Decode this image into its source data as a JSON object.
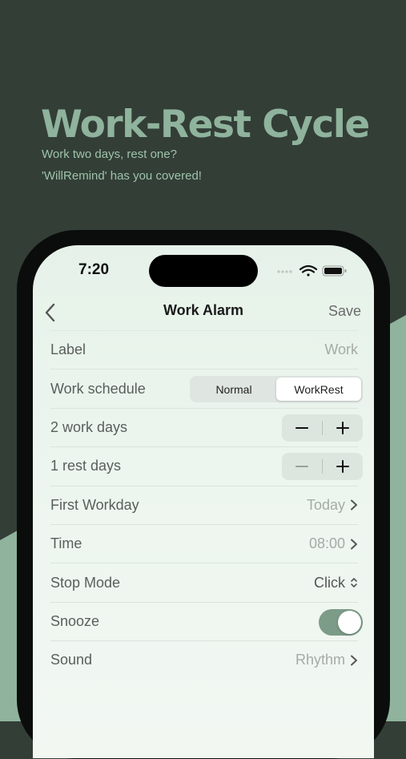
{
  "promo": {
    "headline": "Work-Rest Cycle",
    "subtitle_line1": "Work two days, rest one?",
    "subtitle_line2": "'WillRemind' has you covered!"
  },
  "status_bar": {
    "time": "7:20"
  },
  "nav": {
    "title": "Work Alarm",
    "save_label": "Save"
  },
  "rows": {
    "label": {
      "label": "Label",
      "value": "Work"
    },
    "schedule": {
      "label": "Work schedule",
      "options": [
        "Normal",
        "WorkRest"
      ],
      "selected": "WorkRest"
    },
    "work_days": {
      "label": "2 work days"
    },
    "rest_days": {
      "label": "1 rest days"
    },
    "first_workday": {
      "label": "First Workday",
      "value": "Today"
    },
    "time": {
      "label": "Time",
      "value": "08:00"
    },
    "stop_mode": {
      "label": "Stop Mode",
      "value": "Click"
    },
    "snooze": {
      "label": "Snooze",
      "enabled": true
    },
    "sound": {
      "label": "Sound",
      "value": "Rhythm"
    }
  },
  "icons": [
    "chevron-left-icon",
    "chevron-right-icon",
    "up-down-chevron-icon",
    "minus-icon",
    "plus-icon",
    "cellular-icon",
    "wifi-icon",
    "battery-icon"
  ],
  "colors": {
    "background": "#333e37",
    "accent_green": "#8fb39c",
    "toggle_on": "#7c9c88"
  }
}
